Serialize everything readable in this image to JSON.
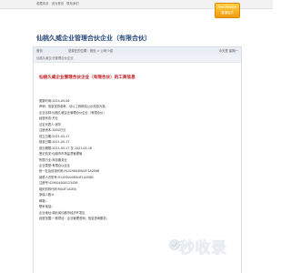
{
  "topbar": {
    "links": [
      "收藏本页",
      "设为首页",
      "联系我们"
    ]
  },
  "member_badge": {
    "line1": "Free Member",
    "line2": "普通会员"
  },
  "company_title": "仙桃久威企业管理合伙企业（有限合伙）",
  "navbar": {
    "home_label": "首页",
    "breadcrumb": "您现在的位置：首页 > 公司介绍",
    "right_label": "今天是 星期一"
  },
  "side_head": "仙桃久威企业管理合伙企业",
  "content_title": "仙桃久威企业管理合伙企业（有限合伙）的工商信息",
  "lines": [
    "更新时间:2024-09-06",
    "声明：信息仅供参考，请以工商网站公示信息为准。",
    "企业名称:仙桃久威企业管理合伙企业（有限合伙）",
    "经营状态:开业",
    "法定代表人:张华",
    "注册资本:3000万元",
    "成立日期:2021-05-17",
    "核准日期:2021-05-17",
    "营业期限:2021-05-17 至 2041-05-16",
    "登记机关:仙桃市市场监督管理局",
    "所属行业:商务服务业",
    "企业类型:有限合伙企业",
    "统一社会信用代码:91429004MA4F1A2E6B",
    "纳税人识别号:91429004MA4F1A2E6B",
    "注册号:429004000123456",
    "组织机构代码:MA4F1A2E6",
    "参保人数:0",
    "邮箱:-",
    "联系电话:-",
    "企业地址:湖北省仙桃市经济开发区",
    "经营范围:一般项目：企业管理咨询；信息咨询服务；"
  ],
  "watermark_logo": "秒收录"
}
